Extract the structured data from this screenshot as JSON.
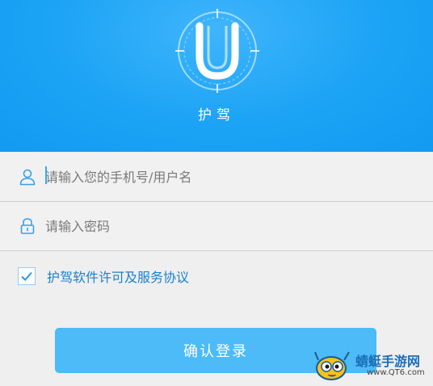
{
  "header": {
    "app_name": "护驾",
    "logo_icon": "u-compass-logo-icon",
    "background_color": "#1ba3f5"
  },
  "login": {
    "username_placeholder": "请输入您的手机号/用户名",
    "password_placeholder": "请输入密码",
    "username_icon": "user-icon",
    "password_icon": "lock-icon"
  },
  "agreement": {
    "checked": true,
    "label": "护驾软件许可及服务协议",
    "link_color": "#1b7fd0"
  },
  "confirm": {
    "label": "确认登录",
    "color": "#4cbbf7"
  },
  "watermark": {
    "title": "蜻蜓手游网",
    "url": "www.QT6.com"
  }
}
